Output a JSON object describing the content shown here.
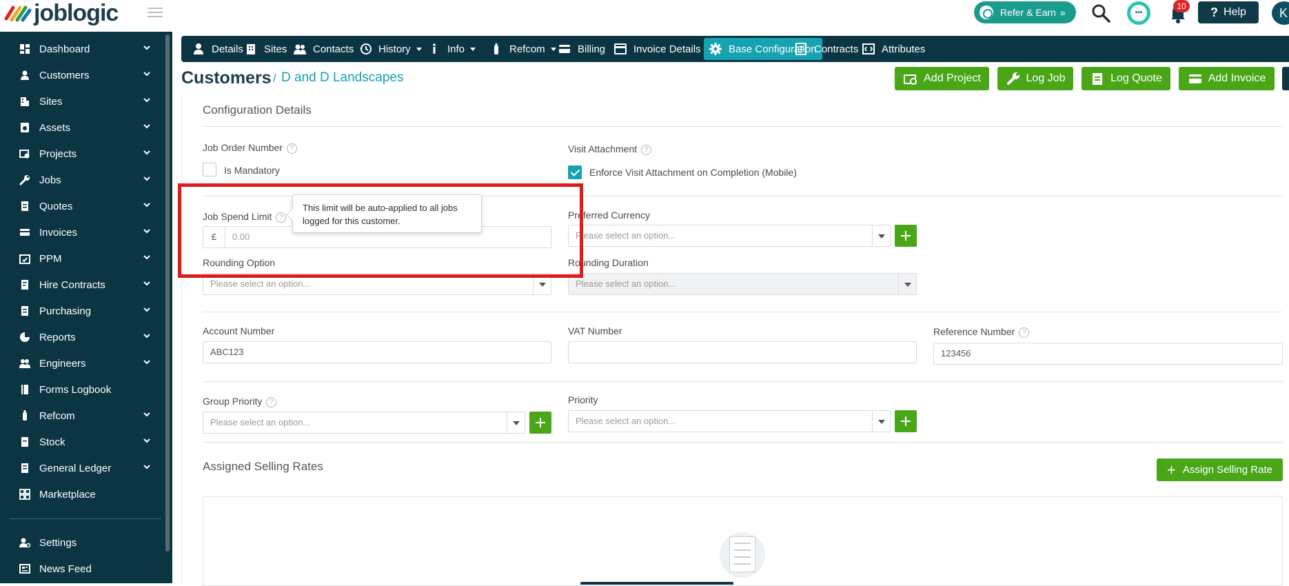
{
  "brand": {
    "name": "joblogic"
  },
  "topbar": {
    "refer_label": "Refer & Earn",
    "notification_count": "10",
    "help_label": "Help",
    "avatar_initial": "K"
  },
  "sidebar": {
    "items": [
      {
        "label": "Dashboard",
        "icon": "dashboard-icon"
      },
      {
        "label": "Customers",
        "icon": "customers-icon"
      },
      {
        "label": "Sites",
        "icon": "sites-icon"
      },
      {
        "label": "Assets",
        "icon": "assets-icon"
      },
      {
        "label": "Projects",
        "icon": "projects-icon"
      },
      {
        "label": "Jobs",
        "icon": "wrench-icon"
      },
      {
        "label": "Quotes",
        "icon": "quotes-icon"
      },
      {
        "label": "Invoices",
        "icon": "invoices-icon"
      },
      {
        "label": "PPM",
        "icon": "calendar-icon"
      },
      {
        "label": "Hire Contracts",
        "icon": "contract-icon"
      },
      {
        "label": "Purchasing",
        "icon": "purchasing-icon"
      },
      {
        "label": "Reports",
        "icon": "pie-chart-icon"
      },
      {
        "label": "Engineers",
        "icon": "engineers-icon"
      },
      {
        "label": "Forms Logbook",
        "icon": "book-icon"
      },
      {
        "label": "Refcom",
        "icon": "refcom-icon"
      },
      {
        "label": "Stock",
        "icon": "stock-icon"
      },
      {
        "label": "General Ledger",
        "icon": "ledger-icon"
      },
      {
        "label": "Marketplace",
        "icon": "marketplace-icon"
      }
    ],
    "footer_items": [
      {
        "label": "Settings",
        "icon": "settings-icon"
      },
      {
        "label": "News Feed",
        "icon": "news-icon"
      }
    ]
  },
  "tabs": [
    {
      "label": "Details",
      "icon": "person-icon"
    },
    {
      "label": "Sites",
      "icon": "building-icon"
    },
    {
      "label": "Contacts",
      "icon": "contacts-icon"
    },
    {
      "label": "History",
      "icon": "history-icon"
    },
    {
      "label": "Info",
      "icon": "info-icon"
    },
    {
      "label": "Refcom",
      "icon": "cylinder-icon"
    },
    {
      "label": "Billing",
      "icon": "card-icon"
    },
    {
      "label": "Invoice Details",
      "icon": "invoice-icon"
    },
    {
      "label": "Base Configuration",
      "icon": "gear-icon"
    },
    {
      "label": "Contracts",
      "icon": "contracts-icon"
    },
    {
      "label": "Attributes",
      "icon": "attributes-icon"
    }
  ],
  "breadcrumb": {
    "root": "Customers",
    "separator": "/",
    "current": "D and D Landscapes"
  },
  "actions": {
    "add_project": "Add Project",
    "log_job": "Log Job",
    "log_quote": "Log Quote",
    "add_invoice": "Add Invoice"
  },
  "config": {
    "section_title": "Configuration Details",
    "job_order_number_label": "Job Order Number",
    "is_mandatory_label": "Is Mandatory",
    "visit_attachment_label": "Visit Attachment",
    "enforce_visit_label": "Enforce Visit Attachment on Completion (Mobile)",
    "job_spend_limit_label": "Job Spend Limit",
    "currency_symbol": "£",
    "job_spend_placeholder": "0.00",
    "tooltip_text": "This limit will be auto-applied to all jobs logged for this customer.",
    "preferred_currency_label": "Preferred Currency",
    "select_placeholder": "Please select an option...",
    "rounding_option_label": "Rounding Option",
    "rounding_duration_label": "Rounding Duration",
    "account_number_label": "Account Number",
    "account_number_value": "ABC123",
    "vat_number_label": "VAT Number",
    "vat_number_value": "",
    "reference_number_label": "Reference Number",
    "reference_number_value": "123456",
    "group_priority_label": "Group Priority",
    "priority_label": "Priority"
  },
  "selling_rates": {
    "title": "Assigned Selling Rates",
    "assign_label": "Assign Selling Rate"
  },
  "colors": {
    "sidebar_bg": "#0c3543",
    "accent_teal": "#16a2b0",
    "action_green": "#48a617",
    "highlight_red": "#e01b1b"
  }
}
